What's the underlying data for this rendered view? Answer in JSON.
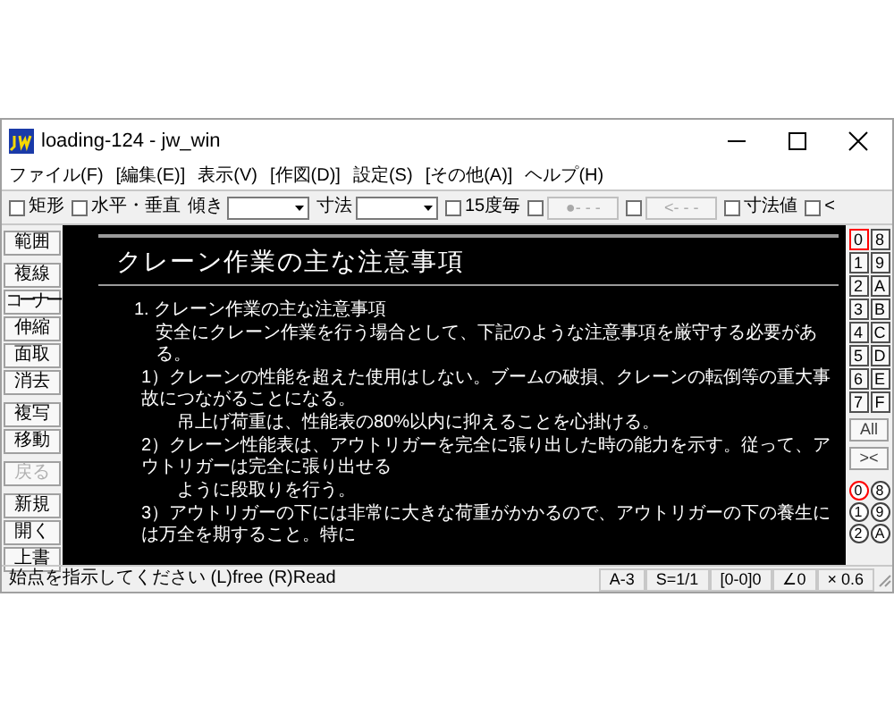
{
  "window": {
    "title": "loading-124 - jw_win"
  },
  "menu": [
    "ファイル(F)",
    "[編集(E)]",
    "表示(V)",
    "[作図(D)]",
    "設定(S)",
    "[その他(A)]",
    "ヘルプ(H)"
  ],
  "toolbar": [
    {
      "kind": "checkbox",
      "label": "矩形",
      "checked": false
    },
    {
      "kind": "checkbox",
      "label": "水平・垂直",
      "checked": false
    },
    {
      "kind": "combo",
      "label": "傾き"
    },
    {
      "kind": "combo",
      "label": "寸法"
    },
    {
      "kind": "checkbox",
      "label": "15度毎",
      "checked": false
    },
    {
      "kind": "checkbox_button",
      "button": "●- - -",
      "checked": false,
      "disabled": true
    },
    {
      "kind": "checkbox_button",
      "button": "<- - -",
      "checked": false,
      "disabled": true
    },
    {
      "kind": "checkbox",
      "label": "寸法値",
      "checked": false
    },
    {
      "kind": "checkbox",
      "label": "<",
      "checked": false
    }
  ],
  "tool_groups": [
    {
      "items": [
        {
          "label": "範囲",
          "disabled": false
        }
      ]
    },
    {
      "items": [
        {
          "label": "複線",
          "disabled": false
        },
        {
          "label": "コーナー",
          "disabled": false
        },
        {
          "label": "伸縮",
          "disabled": false
        },
        {
          "label": "面取",
          "disabled": false
        },
        {
          "label": "消去",
          "disabled": false
        }
      ]
    },
    {
      "items": [
        {
          "label": "複写",
          "disabled": false
        },
        {
          "label": "移動",
          "disabled": false
        }
      ]
    },
    {
      "items": [
        {
          "label": "戻る",
          "disabled": true
        }
      ]
    },
    {
      "items": [
        {
          "label": "新規",
          "disabled": false
        },
        {
          "label": "開く",
          "disabled": false
        },
        {
          "label": "上書",
          "disabled": false
        }
      ]
    }
  ],
  "canvas": {
    "title": "クレーン作業の主な注意事項",
    "lines": [
      {
        "kind": "section",
        "text": "1. クレーン作業の主な注意事項"
      },
      {
        "kind": "paragraph",
        "text": "安全にクレーン作業を行う場合として、下記のような注意事項を厳守する必要がある。"
      },
      {
        "kind": "item",
        "text": "1）クレーンの性能を超えた使用はしない。ブームの破損、クレーンの転倒等の重大事故につながることになる。"
      },
      {
        "kind": "continuation",
        "text": "吊上げ荷重は、性能表の80%以内に抑えることを心掛ける。"
      },
      {
        "kind": "item",
        "text": "2）クレーン性能表は、アウトリガーを完全に張り出した時の能力を示す。従って、アウトリガーは完全に張り出せる"
      },
      {
        "kind": "continuation",
        "text": "ように段取りを行う。"
      },
      {
        "kind": "item",
        "text": "3）アウトリガーの下には非常に大きな荷重がかかるので、アウトリガーの下の養生には万全を期すること。特に"
      }
    ]
  },
  "layers": [
    {
      "label": "0",
      "selected": true
    },
    {
      "label": "8",
      "selected": false
    },
    {
      "label": "1",
      "selected": false
    },
    {
      "label": "9",
      "selected": false
    },
    {
      "label": "2",
      "selected": false
    },
    {
      "label": "A",
      "selected": false
    },
    {
      "label": "3",
      "selected": false
    },
    {
      "label": "B",
      "selected": false
    },
    {
      "label": "4",
      "selected": false
    },
    {
      "label": "C",
      "selected": false
    },
    {
      "label": "5",
      "selected": false
    },
    {
      "label": "D",
      "selected": false
    },
    {
      "label": "6",
      "selected": false
    },
    {
      "label": "E",
      "selected": false
    },
    {
      "label": "7",
      "selected": false
    },
    {
      "label": "F",
      "selected": false
    }
  ],
  "layer_buttons": [
    "All",
    "><"
  ],
  "layer_groups": [
    {
      "label": "0",
      "selected": true
    },
    {
      "label": "8",
      "selected": false
    },
    {
      "label": "1",
      "selected": false
    },
    {
      "label": "9",
      "selected": false
    },
    {
      "label": "2",
      "selected": false
    },
    {
      "label": "A",
      "selected": false
    }
  ],
  "status_bar": {
    "message": "始点を指示してください (L)free (R)Read",
    "fields": [
      "A-3",
      "S=1/1",
      "[0-0]0",
      "∠0",
      "× 0.6"
    ]
  }
}
